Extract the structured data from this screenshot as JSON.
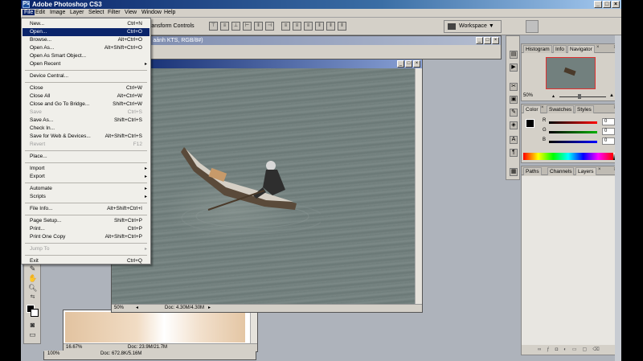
{
  "window": {
    "title": "Adobe Photoshop CS3",
    "app_icon": "Ps"
  },
  "menubar": [
    "File",
    "Edit",
    "Image",
    "Layer",
    "Select",
    "Filter",
    "View",
    "Window",
    "Help"
  ],
  "options_bar": {
    "transform_label": "ransform Controls",
    "workspace_label": "Workspace ▼"
  },
  "file_menu": [
    {
      "label": "New...",
      "shortcut": "Ctrl+N"
    },
    {
      "label": "Open...",
      "shortcut": "Ctrl+O",
      "selected": true
    },
    {
      "label": "Browse...",
      "shortcut": "Alt+Ctrl+O"
    },
    {
      "label": "Open As...",
      "shortcut": "Alt+Shift+Ctrl+O"
    },
    {
      "label": "Open As Smart Object..."
    },
    {
      "label": "Open Recent",
      "submenu": true
    },
    {
      "sep": true
    },
    {
      "label": "Device Central..."
    },
    {
      "sep": true
    },
    {
      "label": "Close",
      "shortcut": "Ctrl+W"
    },
    {
      "label": "Close All",
      "shortcut": "Alt+Ctrl+W"
    },
    {
      "label": "Close and Go To Bridge...",
      "shortcut": "Shift+Ctrl+W"
    },
    {
      "label": "Save",
      "shortcut": "Ctrl+S",
      "disabled": true
    },
    {
      "label": "Save As...",
      "shortcut": "Shift+Ctrl+S"
    },
    {
      "label": "Check In..."
    },
    {
      "label": "Save for Web & Devices...",
      "shortcut": "Alt+Shift+Ctrl+S"
    },
    {
      "label": "Revert",
      "shortcut": "F12",
      "disabled": true
    },
    {
      "sep": true
    },
    {
      "label": "Place..."
    },
    {
      "sep": true
    },
    {
      "label": "Import",
      "submenu": true
    },
    {
      "label": "Export",
      "submenu": true
    },
    {
      "sep": true
    },
    {
      "label": "Automate",
      "submenu": true
    },
    {
      "label": "Scripts",
      "submenu": true
    },
    {
      "sep": true
    },
    {
      "label": "File Info...",
      "shortcut": "Alt+Shift+Ctrl+I"
    },
    {
      "sep": true
    },
    {
      "label": "Page Setup...",
      "shortcut": "Shift+Ctrl+P"
    },
    {
      "label": "Print...",
      "shortcut": "Ctrl+P"
    },
    {
      "label": "Print One Copy",
      "shortcut": "Alt+Shift+Ctrl+P"
    },
    {
      "sep": true
    },
    {
      "label": "Jump To",
      "submenu": true,
      "disabled": true
    },
    {
      "sep": true
    },
    {
      "label": "Exit",
      "shortcut": "Ctrl+Q"
    }
  ],
  "doc_back": {
    "title": "ch aảnh KTS, RGB/8#)"
  },
  "doc_main": {
    "title": "8)",
    "zoom": "50%",
    "doc_size": "Doc: 4.30M/4.30M"
  },
  "doc_bottom": {
    "zoom": "16.67%",
    "doc_size": "Doc: 23.9M/21.7M"
  },
  "doc_bottom2": {
    "zoom": "100%",
    "doc_size": "Doc: 672.8K/5.16M"
  },
  "navigator_panel": {
    "tabs": [
      "Histogram",
      "Info",
      "Navigator"
    ],
    "active": "Navigator",
    "zoom": "50%"
  },
  "color_panel": {
    "tabs": [
      "Color",
      "Swatches",
      "Styles"
    ],
    "active": "Color",
    "channels": [
      {
        "name": "R",
        "value": "0",
        "color": "#ff0000"
      },
      {
        "name": "G",
        "value": "0",
        "color": "#00b000"
      },
      {
        "name": "B",
        "value": "0",
        "color": "#0000ff"
      }
    ]
  },
  "layers_panel": {
    "tabs": [
      "Paths",
      "Channels",
      "Layers"
    ],
    "active": "Layers"
  },
  "colors": {
    "menu_selected": "#0a246a",
    "title_bar": "#0a246a",
    "workspace_bg": "#aeb3bb"
  }
}
